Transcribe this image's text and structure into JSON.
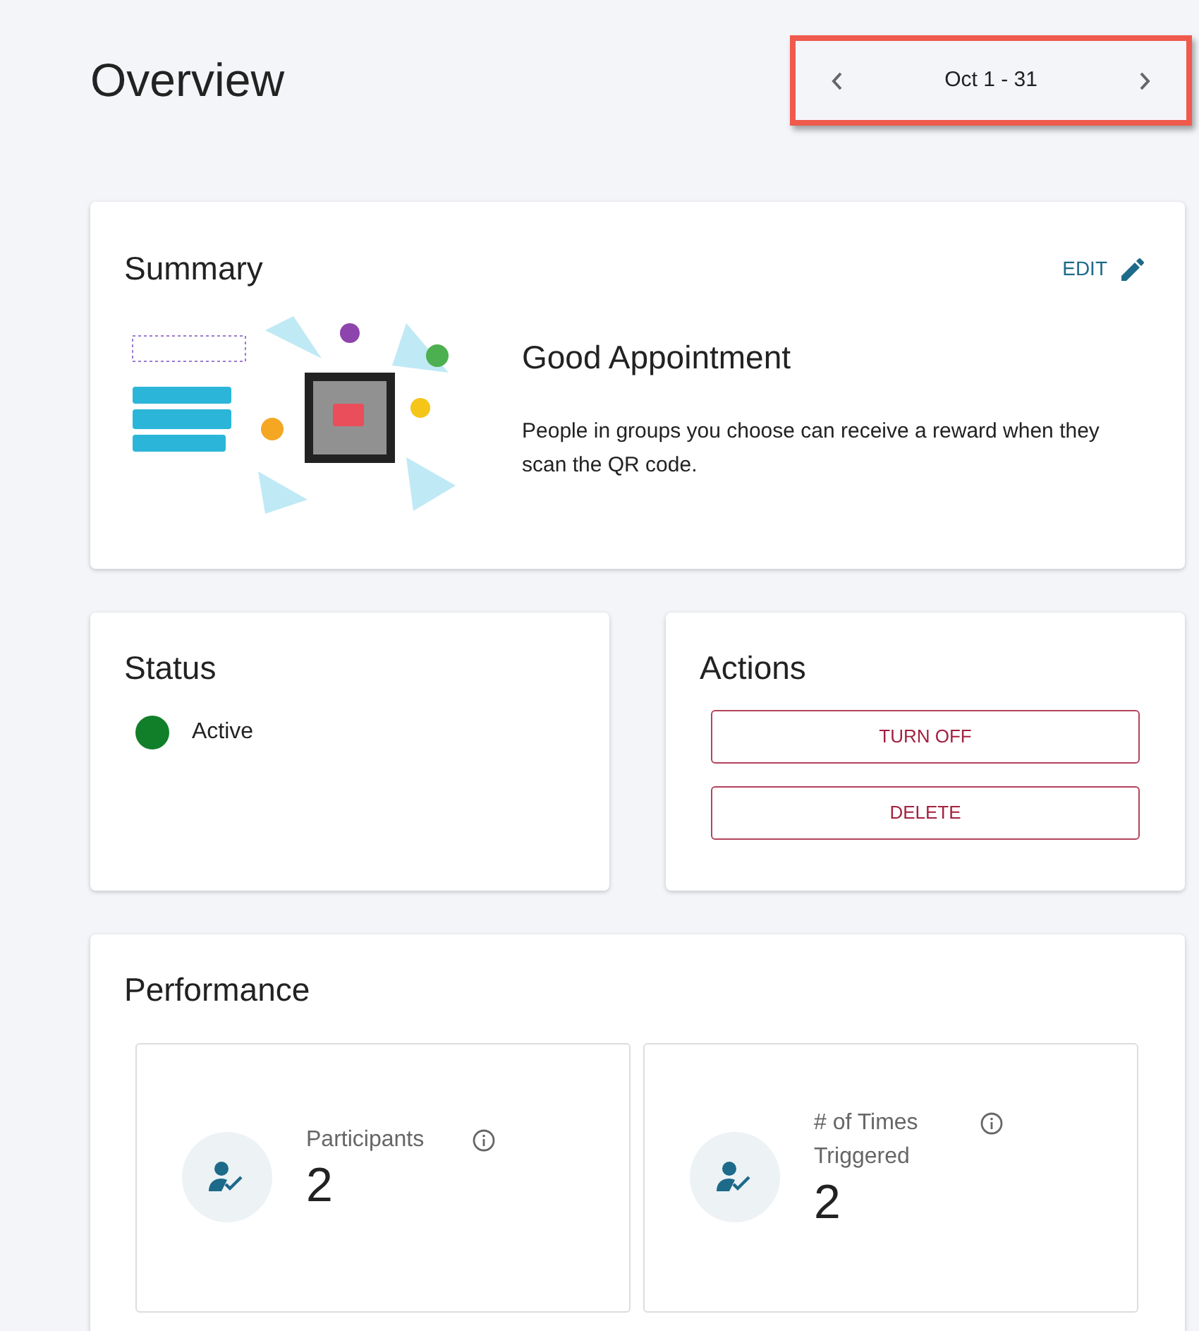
{
  "page_title": "Overview",
  "date_range": {
    "label": "Oct 1 - 31",
    "highlighted": true
  },
  "summary": {
    "title": "Summary",
    "edit_label": "EDIT",
    "name": "Good Appointment",
    "description": "People in groups you choose can receive a reward when they scan the QR code."
  },
  "status": {
    "title": "Status",
    "label": "Active",
    "active": true
  },
  "actions": {
    "title": "Actions",
    "buttons": [
      "TURN OFF",
      "DELETE"
    ]
  },
  "performance": {
    "title": "Performance",
    "metrics": [
      {
        "label": "Participants",
        "value": "2"
      },
      {
        "label": "# of Times Triggered",
        "value": "2"
      }
    ]
  }
}
